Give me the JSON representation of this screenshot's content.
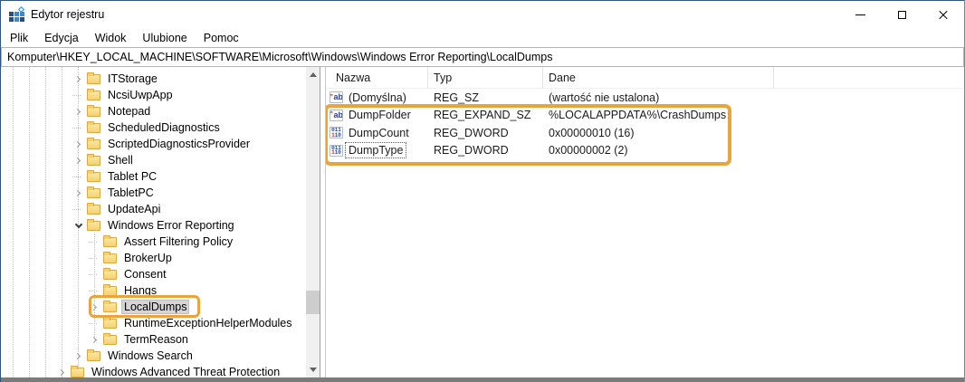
{
  "window": {
    "title": "Edytor rejestru",
    "icon": "registry-icon",
    "controls": {
      "minimize": "minimize",
      "maximize": "maximize",
      "close": "close"
    }
  },
  "menu": [
    "Plik",
    "Edycja",
    "Widok",
    "Ulubione",
    "Pomoc"
  ],
  "address_bar": {
    "path": "Komputer\\HKEY_LOCAL_MACHINE\\SOFTWARE\\Microsoft\\Windows\\Windows Error Reporting\\LocalDumps"
  },
  "tree": {
    "items": [
      {
        "label": "ITStorage",
        "level": 1,
        "expander": "collapsed",
        "selected": false,
        "highlighted": false
      },
      {
        "label": "NcsiUwpApp",
        "level": 1,
        "expander": "none",
        "selected": false,
        "highlighted": false
      },
      {
        "label": "Notepad",
        "level": 1,
        "expander": "collapsed",
        "selected": false,
        "highlighted": false
      },
      {
        "label": "ScheduledDiagnostics",
        "level": 1,
        "expander": "none",
        "selected": false,
        "highlighted": false
      },
      {
        "label": "ScriptedDiagnosticsProvider",
        "level": 1,
        "expander": "collapsed",
        "selected": false,
        "highlighted": false
      },
      {
        "label": "Shell",
        "level": 1,
        "expander": "collapsed",
        "selected": false,
        "highlighted": false
      },
      {
        "label": "Tablet PC",
        "level": 1,
        "expander": "none",
        "selected": false,
        "highlighted": false
      },
      {
        "label": "TabletPC",
        "level": 1,
        "expander": "collapsed",
        "selected": false,
        "highlighted": false
      },
      {
        "label": "UpdateApi",
        "level": 1,
        "expander": "none",
        "selected": false,
        "highlighted": false
      },
      {
        "label": "Windows Error Reporting",
        "level": 1,
        "expander": "expanded",
        "selected": false,
        "highlighted": false
      },
      {
        "label": "Assert Filtering Policy",
        "level": 2,
        "expander": "none",
        "selected": false,
        "highlighted": false
      },
      {
        "label": "BrokerUp",
        "level": 2,
        "expander": "none",
        "selected": false,
        "highlighted": false
      },
      {
        "label": "Consent",
        "level": 2,
        "expander": "none",
        "selected": false,
        "highlighted": false
      },
      {
        "label": "Hangs",
        "level": 2,
        "expander": "none",
        "selected": false,
        "highlighted": false
      },
      {
        "label": "LocalDumps",
        "level": 2,
        "expander": "collapsed",
        "selected": true,
        "highlighted": true
      },
      {
        "label": "RuntimeExceptionHelperModules",
        "level": 2,
        "expander": "none",
        "selected": false,
        "highlighted": false
      },
      {
        "label": "TermReason",
        "level": 2,
        "expander": "collapsed",
        "selected": false,
        "highlighted": false
      },
      {
        "label": "Windows Search",
        "level": 1,
        "expander": "collapsed",
        "selected": false,
        "highlighted": false
      },
      {
        "label": "Windows Advanced Threat Protection",
        "level": 0,
        "expander": "collapsed",
        "selected": false,
        "highlighted": false
      }
    ]
  },
  "values": {
    "columns": [
      "Nazwa",
      "Typ",
      "Dane"
    ],
    "rows": [
      {
        "icon": "string-value-icon",
        "name": "(Domyślna)",
        "type": "REG_SZ",
        "data": "(wartość nie ustalona)",
        "highlighted": false,
        "focused": false
      },
      {
        "icon": "string-value-icon",
        "name": "DumpFolder",
        "type": "REG_EXPAND_SZ",
        "data": "%LOCALAPPDATA%\\CrashDumps",
        "highlighted": true,
        "focused": false
      },
      {
        "icon": "dword-value-icon",
        "name": "DumpCount",
        "type": "REG_DWORD",
        "data": "0x00000010 (16)",
        "highlighted": true,
        "focused": false
      },
      {
        "icon": "dword-value-icon",
        "name": "DumpType",
        "type": "REG_DWORD",
        "data": "0x00000002 (2)",
        "highlighted": true,
        "focused": true
      }
    ]
  },
  "annotations": {
    "highlight_color": "#e9a43c"
  }
}
